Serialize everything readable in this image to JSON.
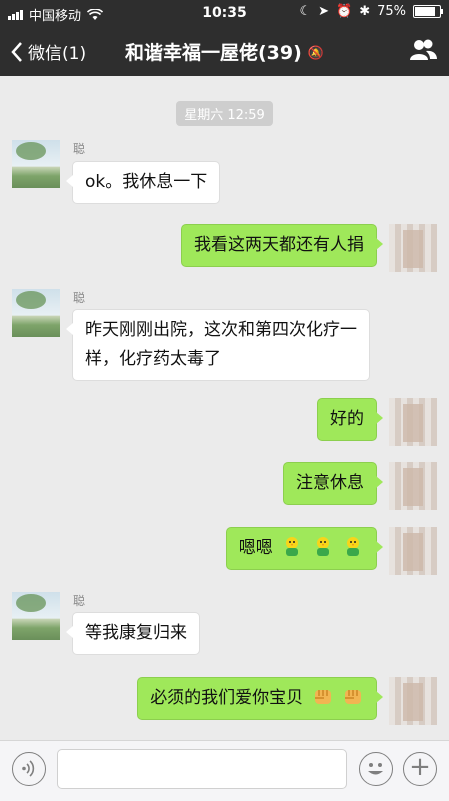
{
  "status_bar": {
    "carrier": "中国移动",
    "time": "10:35",
    "battery": "75%"
  },
  "nav": {
    "back_label": "微信(1)",
    "title": "和谐幸福一屋佬(39)"
  },
  "timestamp": "星期六 12:59",
  "messages": [
    {
      "side": "left",
      "sender": "聪",
      "text": "ok。我休息一下"
    },
    {
      "side": "right",
      "text": "我看这两天都还有人捐"
    },
    {
      "side": "left",
      "sender": "聪",
      "text": "昨天刚刚出院，这次和第四次化疗一样，化疗药太毒了"
    },
    {
      "side": "right",
      "text": "好的"
    },
    {
      "side": "right",
      "text": "注意休息"
    },
    {
      "side": "right",
      "text": "嗯嗯",
      "emoji": [
        "chick-emoji",
        "chick-emoji",
        "chick-emoji"
      ]
    },
    {
      "side": "left",
      "sender": "聪",
      "text": "等我康复归来"
    },
    {
      "side": "right",
      "text": "必须的我们爱你宝贝",
      "emoji": [
        "fist-emoji",
        "fist-emoji"
      ]
    }
  ],
  "colors": {
    "nav_bg": "#2e2e2e",
    "outgoing_bubble": "#9fe85a",
    "incoming_bubble": "#ffffff",
    "chat_bg": "#ebebeb"
  },
  "input_bar": {
    "icons": [
      "voice-icon",
      "emoji-icon",
      "plus-icon"
    ]
  }
}
